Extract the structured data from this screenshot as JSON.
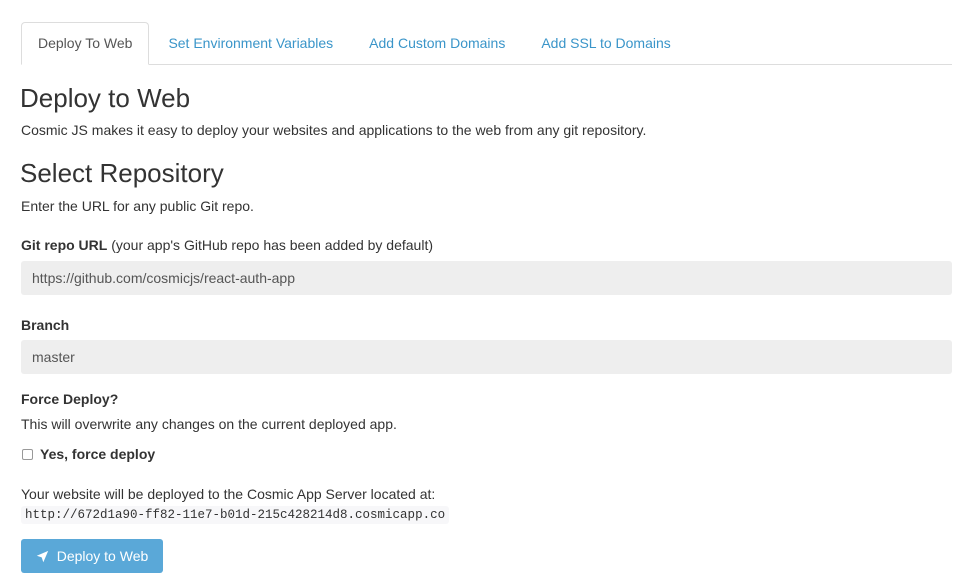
{
  "tabs": [
    {
      "label": "Deploy To Web",
      "active": true
    },
    {
      "label": "Set Environment Variables",
      "active": false
    },
    {
      "label": "Add Custom Domains",
      "active": false
    },
    {
      "label": "Add SSL to Domains",
      "active": false
    }
  ],
  "page": {
    "title": "Deploy to Web",
    "intro": "Cosmic JS makes it easy to deploy your websites and applications to the web from any git repository."
  },
  "repository": {
    "heading": "Select Repository",
    "description": "Enter the URL for any public Git repo.",
    "git_url_label": "Git repo URL",
    "git_url_note": " (your app's GitHub repo has been added by default)",
    "git_url_value": "https://github.com/cosmicjs/react-auth-app",
    "branch_label": "Branch",
    "branch_value": "master"
  },
  "force_deploy": {
    "label": "Force Deploy?",
    "description": "This will overwrite any changes on the current deployed app.",
    "checkbox_label": "Yes, force deploy",
    "checked": false
  },
  "deploy_target": {
    "text": "Your website will be deployed to the Cosmic App Server located at:",
    "url": "http://672d1a90-ff82-11e7-b01d-215c428214d8.cosmicapp.co"
  },
  "deploy_button": {
    "label": "Deploy to Web",
    "icon": "rocket-icon"
  },
  "colors": {
    "link": "#3a95c9",
    "button": "#5aa8d8",
    "field_bg": "#eeeeee"
  }
}
